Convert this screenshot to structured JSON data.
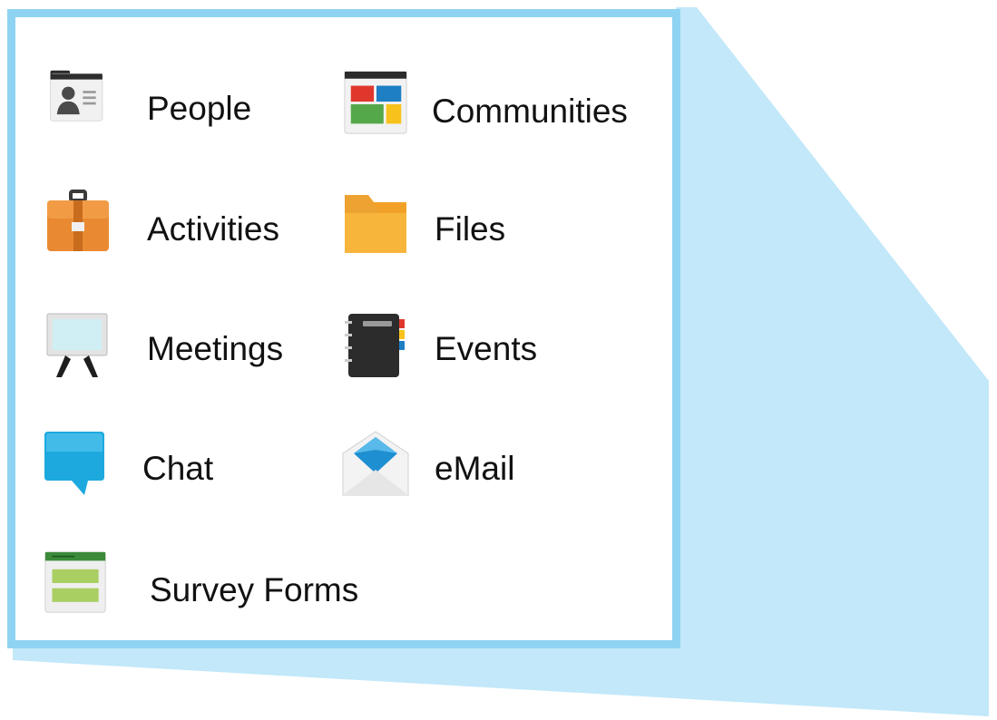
{
  "apps": {
    "people": {
      "label": "People",
      "icon": "contact-card-icon"
    },
    "communities": {
      "label": "Communities",
      "icon": "tiles-grid-icon"
    },
    "activities": {
      "label": "Activities",
      "icon": "briefcase-icon"
    },
    "files": {
      "label": "Files",
      "icon": "folder-icon"
    },
    "meetings": {
      "label": "Meetings",
      "icon": "presentation-board-icon"
    },
    "events": {
      "label": "Events",
      "icon": "notebook-icon"
    },
    "chat": {
      "label": "Chat",
      "icon": "chat-bubble-icon"
    },
    "email": {
      "label": "eMail",
      "icon": "envelope-icon"
    },
    "survey_forms": {
      "label": "Survey Forms",
      "icon": "form-icon"
    }
  },
  "colors": {
    "panel_border": "#8fd3f2",
    "zoom_fill": "#c2e8f9"
  }
}
